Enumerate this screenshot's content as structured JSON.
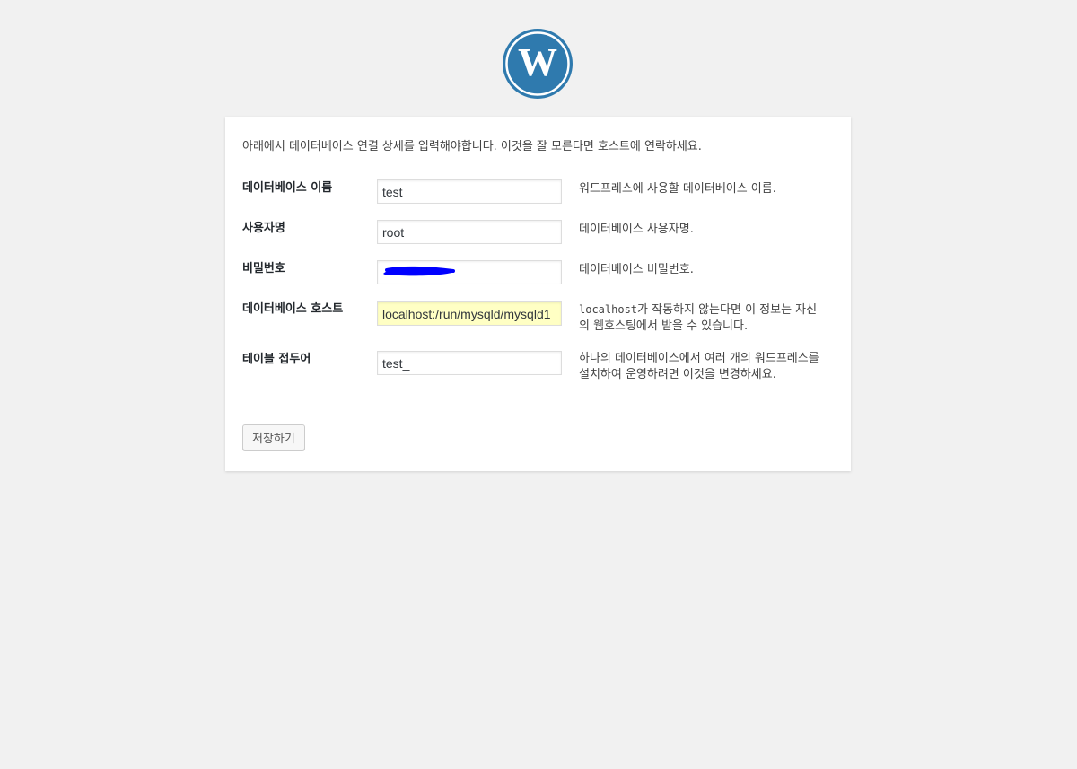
{
  "intro": "아래에서 데이터베이스 연결 상세를 입력해야합니다. 이것을 잘 모른다면 호스트에 연락하세요.",
  "form": {
    "dbname": {
      "label": "데이터베이스 이름",
      "value": "test",
      "desc": "워드프레스에 사용할 데이터베이스 이름."
    },
    "uname": {
      "label": "사용자명",
      "value": "root",
      "desc": "데이터베이스 사용자명."
    },
    "pwd": {
      "label": "비밀번호",
      "value": "",
      "desc": "데이터베이스 비밀번호."
    },
    "dbhost": {
      "label": "데이터베이스 호스트",
      "value": "localhost:/run/mysqld/mysqld1",
      "desc_code": "localhost",
      "desc": "가 작동하지 않는다면 이 정보는 자신의 웹호스팅에서 받을 수 있습니다."
    },
    "prefix": {
      "label": "테이블 접두어",
      "value": "test_",
      "desc": "하나의 데이터베이스에서 여러 개의 워드프레스를 설치하여 운영하려면 이것을 변경하세요."
    }
  },
  "submit_label": "저장하기",
  "colors": {
    "logo": "#2f7aae",
    "redaction": "#0000ff",
    "highlight": "#ffffc4"
  },
  "icons": {
    "logo": "wordpress-logo-icon"
  }
}
